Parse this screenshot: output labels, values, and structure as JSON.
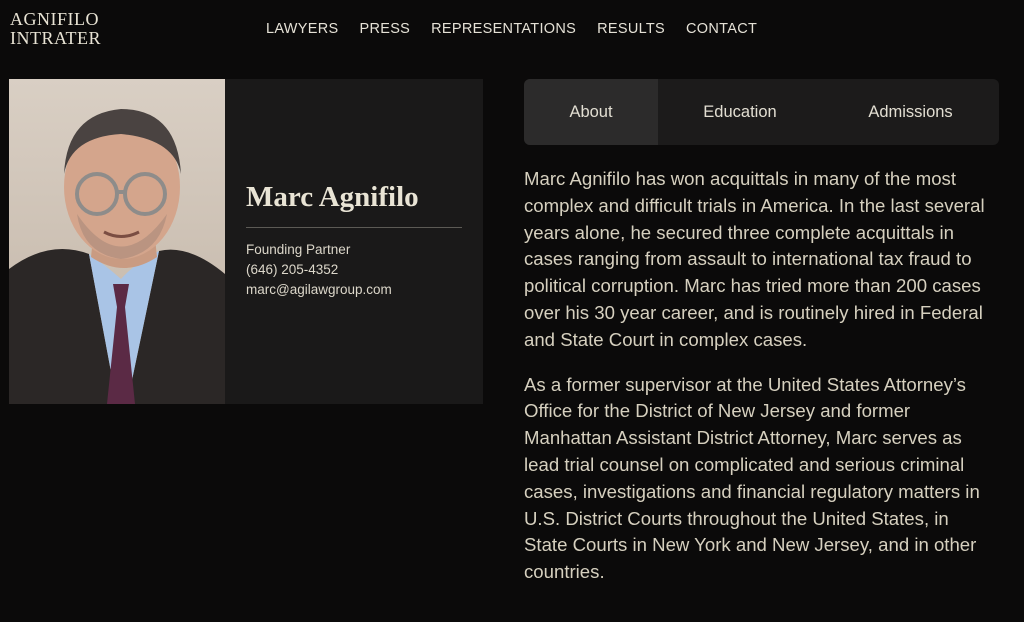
{
  "logo": {
    "line1": "AGNIFILO",
    "line2": "INTRATER"
  },
  "nav": [
    "LAWYERS",
    "PRESS",
    "REPRESENTATIONS",
    "RESULTS",
    "CONTACT"
  ],
  "profile": {
    "name": "Marc Agnifilo",
    "title": "Founding Partner",
    "phone": "(646) 205-4352",
    "email": "marc@agilawgroup.com"
  },
  "tabs": [
    "About",
    "Education",
    "Admissions"
  ],
  "active_tab": "About",
  "bio": [
    "Marc Agnifilo has won acquittals in many of the most complex and difficult trials in America.  In the last several years alone, he secured three complete acquittals in cases ranging from assault to international tax fraud to political corruption. Marc has tried more than 200 cases over his 30 year career, and is routinely hired in Federal and State Court in complex cases.",
    "As a former supervisor at the United States Attorney’s Office for the District of New Jersey and former Manhattan Assistant District Attorney, Marc serves as lead trial counsel on complicated and serious criminal cases, investigations and financial regulatory matters in U.S. District Courts throughout the United States, in State Courts in New York and New Jersey, and in other countries."
  ],
  "colors": {
    "background": "#0b0a0a",
    "card": "#1a1919",
    "tab_active": "#2c2b2b",
    "text": "#d6d0bf"
  }
}
